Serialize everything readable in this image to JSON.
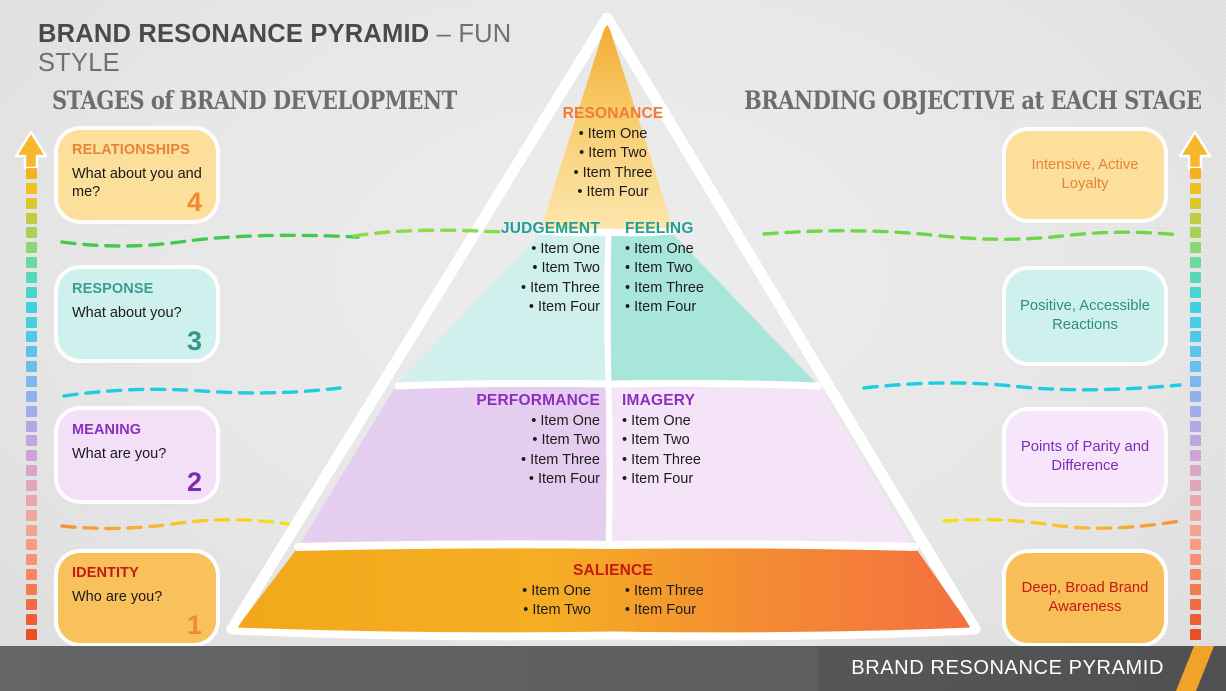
{
  "title": {
    "strong": "BRAND RESONANCE PYRAMID",
    "dash": " – ",
    "light": "FUN STYLE"
  },
  "headings": {
    "left": "STAGES of BRAND DEVELOPMENT",
    "right": "BRANDING OBJECTIVE at EACH STAGE"
  },
  "stages": [
    {
      "title": "RELATIONSHIPS",
      "question": "What about you and me?",
      "number": "4",
      "title_color": "#E8833A",
      "number_color": "#EE8A35",
      "bg": "#FBDF9B"
    },
    {
      "title": "RESPONSE",
      "question": "What about you?",
      "number": "3",
      "title_color": "#3C9C93",
      "number_color": "#35958D",
      "bg": "#CFF1EE"
    },
    {
      "title": "MEANING",
      "question": "What are you?",
      "number": "2",
      "title_color": "#8B2FBE",
      "number_color": "#7B2BB5",
      "bg": "#F3DFF7"
    },
    {
      "title": "IDENTITY",
      "question": "Who are you?",
      "number": "1",
      "title_color": "#C41A14",
      "number_color": "#EE8A35",
      "bg": "#F8C15C"
    }
  ],
  "objectives": [
    {
      "text": "Intensive, Active Loyalty",
      "color": "#E8833A",
      "bg": "#FBDF9B"
    },
    {
      "text": "Positive, Accessible Reactions",
      "color": "#2E8C84",
      "bg": "#CFF1EE"
    },
    {
      "text": "Points of Parity and Difference",
      "color": "#7B2BB5",
      "bg": "#F7E6FB"
    },
    {
      "text": "Deep, Broad Brand Awareness",
      "color": "#C41A14",
      "bg": "#F8BE57"
    }
  ],
  "pyramid": {
    "tiers": [
      {
        "level": "apex",
        "blocks": [
          {
            "title": "RESONANCE",
            "title_color": "#F07B35",
            "items": [
              "Item One",
              "Item Two",
              "Item Three",
              "Item Four"
            ],
            "fill_top": "#F3AE38",
            "fill_bottom": "#FBE3A6"
          }
        ]
      },
      {
        "level": "response",
        "blocks": [
          {
            "title": "JUDGEMENT",
            "title_color": "#1FA097",
            "items": [
              "Item One",
              "Item Two",
              "Item Three",
              "Item Four"
            ],
            "fill": "#CFF0ED"
          },
          {
            "title": "FEELING",
            "title_color": "#1FA097",
            "items": [
              "Item One",
              "Item Two",
              "Item Three",
              "Item Four"
            ],
            "fill": "#A8E6DC"
          }
        ]
      },
      {
        "level": "meaning",
        "blocks": [
          {
            "title": "PERFORMANCE",
            "title_color": "#8B2FBE",
            "items": [
              "Item One",
              "Item Two",
              "Item Three",
              "Item Four"
            ],
            "fill": "#E4CDEF"
          },
          {
            "title": "IMAGERY",
            "title_color": "#8B2FBE",
            "items": [
              "Item One",
              "Item Two",
              "Item Three",
              "Item Four"
            ],
            "fill": "#F5E4F8"
          }
        ]
      },
      {
        "level": "identity",
        "blocks": [
          {
            "title": "SALIENCE",
            "title_color": "#C41A14",
            "items_left": [
              "Item One",
              "Item Two"
            ],
            "items_right": [
              "Item Three",
              "Item Four"
            ],
            "fill_left": "#F2A91B",
            "fill_right": "#F4713F"
          }
        ]
      }
    ]
  },
  "arrow_colors": [
    "#F6B11E",
    "#EFC022",
    "#DCC72B",
    "#C2CC41",
    "#A8D255",
    "#8BD772",
    "#6DD99A",
    "#56D9BA",
    "#45D6D0",
    "#3FD2DE",
    "#45CEE6",
    "#4FC9EA",
    "#5CC3EC",
    "#6CBDEE",
    "#7DB7EF",
    "#8FB2EE",
    "#A0ADEC",
    "#B0A9E6",
    "#BFA6DE",
    "#CCA5D4",
    "#D8A5C8",
    "#E2A6BB",
    "#EBA7AE",
    "#F1A79F",
    "#F5A391",
    "#F79C82",
    "#F89272",
    "#F88662",
    "#F67952",
    "#F36B43",
    "#EF5D34",
    "#E94E26"
  ],
  "arrow_head_color": "#F8B62B",
  "footer": {
    "label": "BRAND RESONANCE PYRAMID",
    "slash_color": "#EFA428"
  },
  "dividers": [
    {
      "name": "green",
      "colors": [
        "#35C05A",
        "#6BD44B",
        "#9ADE47"
      ]
    },
    {
      "name": "cyan",
      "colors": [
        "#16C8DC",
        "#1FCDE0",
        "#2AD2E4"
      ]
    },
    {
      "name": "warm",
      "colors": [
        "#F4923C",
        "#F6C62E",
        "#F2E21F"
      ]
    }
  ]
}
